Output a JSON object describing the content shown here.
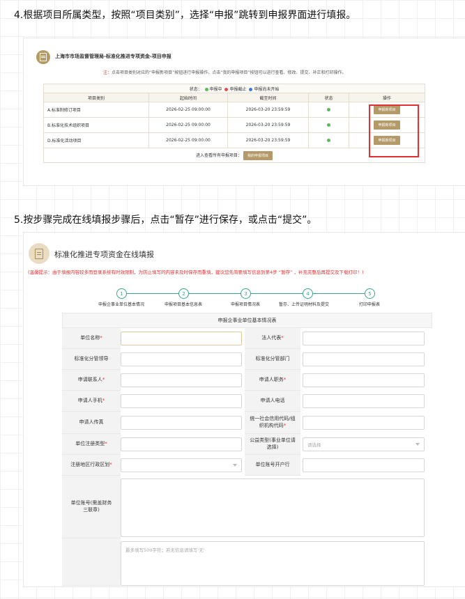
{
  "step4_heading": "4.根据项目所属类型，按照“项目类别”，选择“申报”跳转到申报界面进行填报。",
  "step5_heading": "5.按步骤完成在线填报步骤后，点击“暂存”进行保存，或点击“提交”。",
  "panel1": {
    "title": "上海市市场监督管理局-标准化推进专项资金-项目申报",
    "notice_prefix": "注：",
    "notice_text": "点击项目类别对应的“申报新项目”按钮进行申报操作。点击“我的申报项目”按钮可以进行查看、修改、提交、补正和打印操作。",
    "status_legend": {
      "label": "状态：",
      "open": "申报中",
      "closed": "申报截止",
      "pending": "申报尚未开始"
    },
    "columns": [
      "项目类别",
      "起始时间",
      "截至时间",
      "状态",
      "操作"
    ],
    "rows": [
      {
        "category": "A.标准制修订项目",
        "start": "2026-02-25 09:00:00",
        "end": "2026-03-20 23:59:59",
        "action": "申报新项目"
      },
      {
        "category": "B.标准化技术组织项目",
        "start": "2026-02-25 09:00:00",
        "end": "2026-03-20 23:59:59",
        "action": "申报新项目"
      },
      {
        "category": "D.标准化活动项目",
        "start": "2026-02-25 09:00:00",
        "end": "2026-03-20 23:59:59",
        "action": "申报新项目"
      }
    ],
    "footer_text": "进入查看所有申报项目：",
    "footer_button": "我的申报项目",
    "colors": {
      "accent": "#b49a68",
      "highlight_box": "#e03030"
    }
  },
  "panel2": {
    "title": "标准化推进专项资金在线填报",
    "warning": "(温馨提示：由于填报内容较多而登录系统有时效限制，为防止填写的内容未及时保存而重填，建议您先简要填写信息到第4步 “暂存” ，补充完整后再提交及下载打印！)",
    "steps": [
      {
        "num": "1",
        "label": "申报企事业单位基本情况"
      },
      {
        "num": "2",
        "label": "申报项目基本信息表"
      },
      {
        "num": "3",
        "label": "申报项目情况表"
      },
      {
        "num": "4",
        "label": "暂存、上传证明材料及提交"
      },
      {
        "num": "5",
        "label": "打印申报表"
      }
    ],
    "form_title": "申报企事业单位基本情况表",
    "fields": {
      "unit_name": "单位名称",
      "legal_rep": "法人代表",
      "std_leader": "标准化分管领导",
      "std_dept": "标准化分管部门",
      "contact": "申请联系人",
      "position": "申请人职务",
      "mobile": "申请人手机",
      "phone": "申请人电话",
      "fax": "申请人传真",
      "credit_code": "统一社会信用代码/组织机构代码",
      "reg_type": "单位注册类型",
      "welfare_type": "公益类型(事业单位请选择)",
      "welfare_placeholder": "请选择",
      "region": "注册地区行政区划",
      "bank": "单位账号开户行",
      "account": "单位账号(需盖财务三联章)",
      "textarea_placeholder": "最多填写500字符；若无信息请填写'无'"
    },
    "colors": {
      "step": "#3aa58a",
      "warning": "#e03030"
    }
  }
}
